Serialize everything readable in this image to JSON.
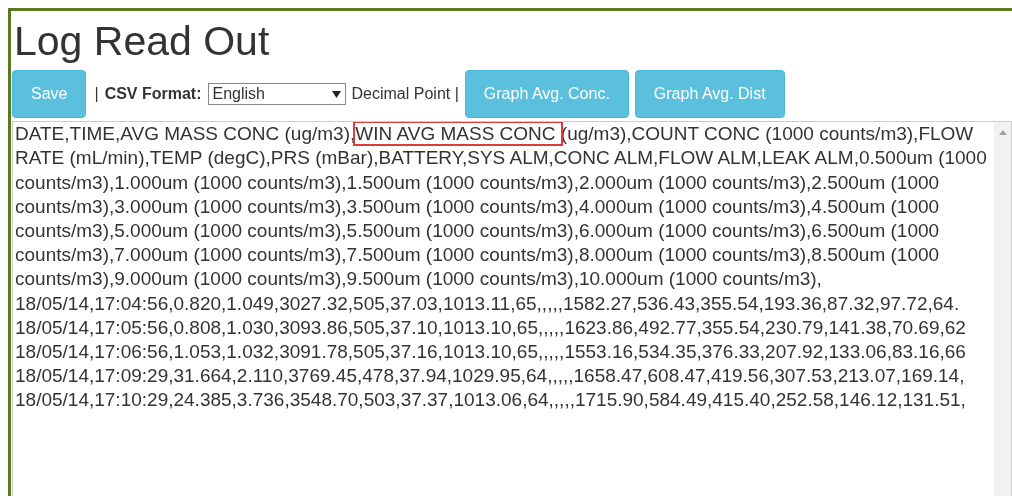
{
  "title": "Log Read Out",
  "toolbar": {
    "save": "Save",
    "separator_1": "|",
    "csv_label": "CSV Format:",
    "csv_value": "English",
    "decimal": "Decimal Point |",
    "buttons": [
      "Graph Avg. Conc.",
      "Graph Avg. Dist"
    ]
  },
  "log": {
    "header": [
      {
        "text": "DATE,TIME,AVG MASS CONC (ug/m3),",
        "highlighted": false
      },
      {
        "text": "WIN AVG MASS CONC ",
        "highlighted": true
      },
      {
        "text": "(ug/m3),COUNT CONC (1000 counts/m3),FLOW RATE (mL/min),TEMP (degC),PRS (mBar),BATTERY,SYS ALM,CONC ALM,FLOW ALM,LEAK ALM,0.500um (1000 counts/m3),1.000um (1000 counts/m3),1.500um (1000 counts/m3),2.000um (1000 counts/m3),2.500um (1000 counts/m3),3.000um (1000 counts/m3),3.500um (1000 counts/m3),4.000um (1000 counts/m3),4.500um (1000 counts/m3),5.000um (1000 counts/m3),5.500um (1000 counts/m3),6.000um (1000 counts/m3),6.500um (1000 counts/m3),7.000um (1000 counts/m3),7.500um (1000 counts/m3),8.000um (1000 counts/m3),8.500um (1000 counts/m3),9.000um (1000 counts/m3),9.500um (1000 counts/m3),10.000um (1000 counts/m3),",
        "highlighted": false
      }
    ],
    "rows": [
      "18/05/14,17:04:56,0.820,1.049,3027.32,505,37.03,1013.11,65,,,,,1582.27,536.43,355.54,193.36,87.32,97.72,64.",
      "18/05/14,17:05:56,0.808,1.030,3093.86,505,37.10,1013.10,65,,,,,1623.86,492.77,355.54,230.79,141.38,70.69,62",
      "18/05/14,17:06:56,1.053,1.032,3091.78,505,37.16,1013.10,65,,,,,1553.16,534.35,376.33,207.92,133.06,83.16,66",
      "18/05/14,17:09:29,31.664,2.110,3769.45,478,37.94,1029.95,64,,,,,1658.47,608.47,419.56,307.53,213.07,169.14,",
      "18/05/14,17:10:29,24.385,3.736,3548.70,503,37.37,1013.06,64,,,,,1715.90,584.49,415.40,252.58,146.12,131.51,"
    ]
  }
}
